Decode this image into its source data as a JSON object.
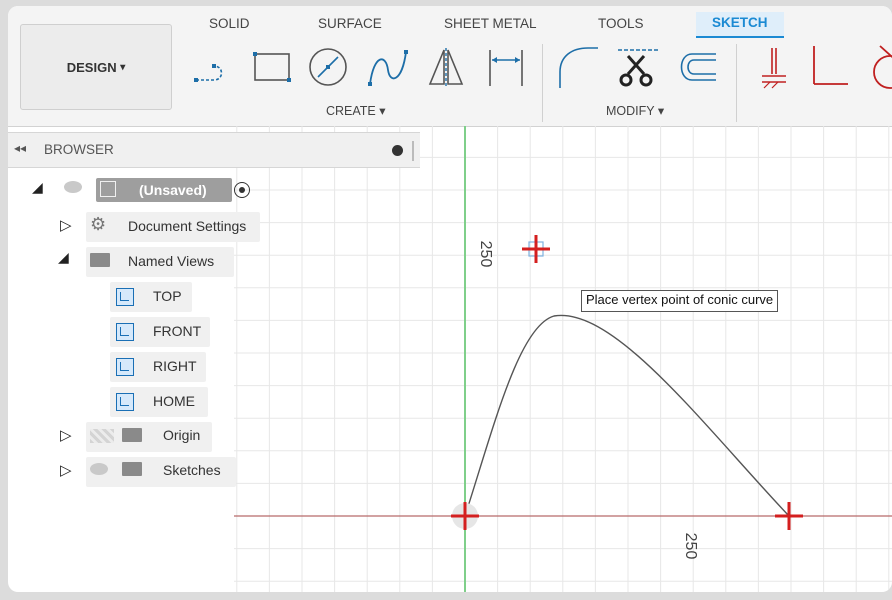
{
  "toolbar": {
    "design_label": "DESIGN",
    "design_caret": "▾",
    "tabs": [
      "SOLID",
      "SURFACE",
      "SHEET METAL",
      "TOOLS",
      "SKETCH"
    ],
    "active_tab": "SKETCH",
    "groups": {
      "create": "CREATE ▾",
      "modify": "MODIFY ▾"
    },
    "tools": [
      "line-icon",
      "rectangle-icon",
      "circle-icon",
      "spline-icon",
      "mirror-icon",
      "dimension-icon",
      "fillet-icon",
      "trim-icon",
      "offset-icon",
      "constraint-icon",
      "inspect-icon",
      "construct-icon"
    ]
  },
  "browser": {
    "collapse_glyph": "◂◂",
    "title": "BROWSER",
    "root_label": "(Unsaved)",
    "items": [
      {
        "label": "Document Settings",
        "expanded": false,
        "icon": "gear-icon"
      },
      {
        "label": "Named Views",
        "expanded": true,
        "icon": "folder-icon"
      },
      {
        "label": "TOP",
        "icon": "view-icon"
      },
      {
        "label": "FRONT",
        "icon": "view-icon"
      },
      {
        "label": "RIGHT",
        "icon": "view-icon"
      },
      {
        "label": "HOME",
        "icon": "view-icon"
      },
      {
        "label": "Origin",
        "expanded": false,
        "icon": "folder-icon"
      },
      {
        "label": "Sketches",
        "expanded": false,
        "icon": "folder-icon"
      }
    ]
  },
  "canvas": {
    "tooltip": "Place vertex point of conic curve",
    "dim_vertical": "250",
    "dim_horizontal": "250",
    "colors": {
      "grid": "#e7e7e7",
      "axis_x": "#b86a6a",
      "axis_y": "#7fcf8a",
      "point": "#d41f1f",
      "curve": "#555555"
    }
  }
}
